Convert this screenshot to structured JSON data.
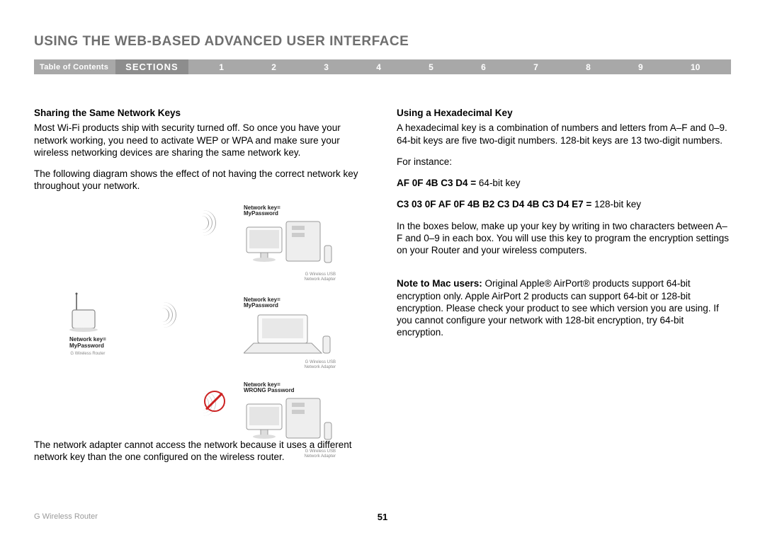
{
  "header": {
    "title": "USING THE WEB-BASED ADVANCED USER INTERFACE"
  },
  "nav": {
    "toc": "Table of Contents",
    "sections_label": "SECTIONS",
    "items": [
      "1",
      "2",
      "3",
      "4",
      "5",
      "6",
      "7",
      "8",
      "9",
      "10"
    ],
    "current": "6"
  },
  "left": {
    "h1": "Sharing the Same Network Keys",
    "p1": "Most Wi-Fi products ship with security turned off. So once you have your network working, you need to activate WEP or WPA and make sure your wireless networking devices are sharing the same network key.",
    "p2": "The following diagram shows the effect of not having the correct network key throughout your network.",
    "p3": "The network adapter cannot access the network because it uses a different network key than the one configured on the wireless router.",
    "diagram": {
      "router_label": "G Wireless Router",
      "key_ok_line1": "Network key=",
      "key_ok_line2": "MyPassword",
      "key_bad_line1": "Network key=",
      "key_bad_line2": "WRONG Password",
      "adapter_label_line1": "G Wireless USB",
      "adapter_label_line2": "Network Adapter"
    }
  },
  "right": {
    "h1": "Using a Hexadecimal Key",
    "p1": "A hexadecimal key is a combination of numbers and letters from A–F and 0–9. 64-bit keys are five two-digit numbers. 128-bit keys are 13 two-digit numbers.",
    "p2": "For instance:",
    "ex1_bold": "AF 0F 4B C3 D4 =",
    "ex1_rest": " 64-bit key",
    "ex2_bold": "C3 03 0F AF 0F 4B B2 C3 D4 4B C3 D4 E7 =",
    "ex2_rest": " 128-bit key",
    "p3": "In the boxes below, make up your key by writing in two characters between A–F and 0–9 in each box. You will use this key to program the encryption settings on your Router and your wireless computers.",
    "note_bold": "Note to Mac users:",
    "note_rest": " Original Apple® AirPort® products support 64-bit encryption only. Apple AirPort 2 products can support 64-bit or 128-bit encryption. Please check your product to see which version you are using. If you cannot configure your network with 128-bit encryption, try 64-bit encryption."
  },
  "footer": {
    "product": "G Wireless Router",
    "page_number": "51"
  }
}
